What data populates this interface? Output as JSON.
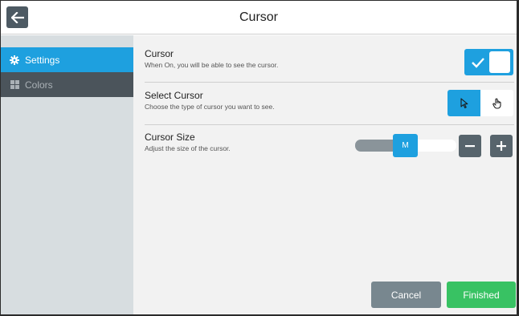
{
  "header": {
    "title": "Cursor",
    "back_icon": "back-arrow-icon"
  },
  "sidebar": {
    "items": [
      {
        "label": "Settings",
        "icon": "gear-icon",
        "active": true
      },
      {
        "label": "Colors",
        "icon": "grid-icon",
        "active": false
      }
    ]
  },
  "settings": {
    "cursor": {
      "title": "Cursor",
      "description": "When On, you will be able to see the cursor.",
      "enabled": true
    },
    "select_cursor": {
      "title": "Select Cursor",
      "description": "Choose the type of cursor you want to see.",
      "options": [
        "arrow-pointer-icon",
        "hand-pointer-icon"
      ],
      "selected": "arrow-pointer-icon"
    },
    "cursor_size": {
      "title": "Cursor Size",
      "description": "Adjust the size of the cursor.",
      "value_label": "M",
      "level": 0.5
    }
  },
  "footer": {
    "cancel_label": "Cancel",
    "finished_label": "Finished"
  },
  "colors": {
    "accent": "#1ea0df",
    "success": "#38c263",
    "sidebar_dark": "#4b545b"
  }
}
